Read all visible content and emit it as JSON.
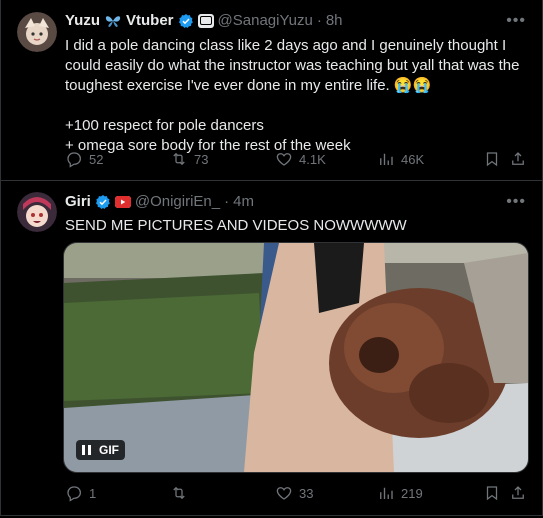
{
  "tweet1": {
    "display_name": "Yuzu",
    "name_suffix": "Vtuber",
    "handle": "@SanagiYuzu",
    "time": "8h",
    "text": "I did a pole dancing class like 2 days ago and I genuinely thought I could easily do what the instructor was teaching but yall that was the toughest exercise I've ever done in my entire life. 😭😭\n\n+100 respect for pole dancers\n+ omega sore body for the rest of the week",
    "replies": "52",
    "reposts": "73",
    "likes": "4.1K",
    "views": "46K"
  },
  "tweet2": {
    "display_name": "Giri",
    "handle": "@OnigiriEn_",
    "time": "4m",
    "text": "SEND ME PICTURES AND VIDEOS NOWWWWW",
    "media_badge": "GIF",
    "replies": "1",
    "reposts": "",
    "likes": "33",
    "views": "219"
  },
  "icons": {
    "reply": "reply-icon",
    "repost": "repost-icon",
    "like": "like-icon",
    "views": "views-icon",
    "bookmark": "bookmark-icon",
    "share": "share-icon"
  },
  "colors": {
    "background": "#000000",
    "text": "#e7e9ea",
    "muted": "#71767b",
    "verified": "#1d9bf0",
    "divider": "#2f3336"
  }
}
